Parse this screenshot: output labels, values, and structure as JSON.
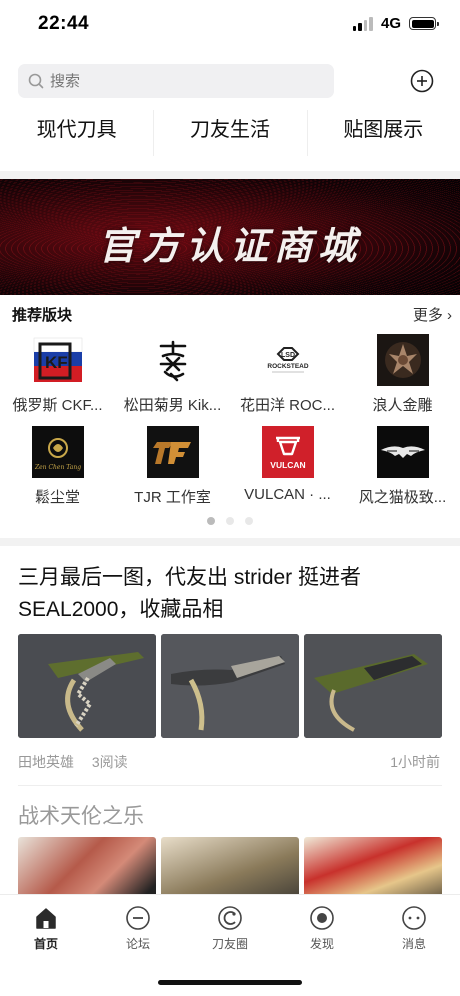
{
  "status_bar": {
    "time": "22:44",
    "network": "4G"
  },
  "search": {
    "placeholder": "搜索"
  },
  "categories": [
    "现代刀具",
    "刀友生活",
    "贴图展示"
  ],
  "banner": {
    "title": "官方认证商城"
  },
  "recommended": {
    "title": "推荐版块",
    "more_label": "更多 ›",
    "brands": [
      {
        "label": "俄罗斯 CKF...",
        "icon": "ckf-logo"
      },
      {
        "label": "松田菊男 Kik...",
        "icon": "kiku-logo"
      },
      {
        "label": "花田洋 ROC...",
        "icon": "rockstead-logo"
      },
      {
        "label": "浪人金雕",
        "icon": "ronin-eagle-logo"
      },
      {
        "label": "鬆尘堂",
        "icon": "songchentang-logo"
      },
      {
        "label": "TJR 工作室",
        "icon": "tjr-logo"
      },
      {
        "label": "VULCAN · ...",
        "icon": "vulcan-logo"
      },
      {
        "label": "风之猫极致...",
        "icon": "wind-cat-logo"
      }
    ],
    "pager": {
      "pages": 3,
      "current": 1
    }
  },
  "post": {
    "title": "三月最后一图，代友出 strider 挺进者 SEAL2000，收藏品相",
    "author": "田地英雄",
    "reads": "3阅读",
    "time": "1小时前"
  },
  "post2": {
    "title": "战术天伦之乐"
  },
  "tabbar": {
    "items": [
      {
        "label": "首页",
        "icon": "home-icon",
        "active": true
      },
      {
        "label": "论坛",
        "icon": "forum-icon",
        "active": false
      },
      {
        "label": "刀友圈",
        "icon": "circle-icon",
        "active": false
      },
      {
        "label": "发现",
        "icon": "discover-icon",
        "active": false
      },
      {
        "label": "消息",
        "icon": "message-icon",
        "active": false
      }
    ]
  },
  "colors": {
    "accent": "#222222",
    "muted": "#999999",
    "banner": "#5a0a12"
  }
}
